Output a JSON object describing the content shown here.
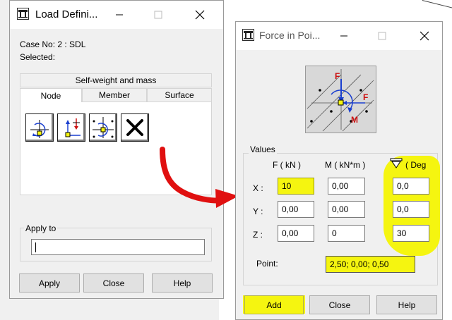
{
  "load_dialog": {
    "title": "Load Defini...",
    "case_label": "Case No: 2 : SDL",
    "selected_label": "Selected:",
    "section_header": "Self-weight and mass",
    "tabs": [
      "Node",
      "Member",
      "Surface"
    ],
    "active_tab": "Node",
    "tool_icons": [
      "nodal-moment-icon",
      "nodal-force-icon",
      "force-in-point-icon",
      "delete-load-icon"
    ],
    "apply_to_label": "Apply to",
    "apply_to_value": "",
    "buttons": {
      "apply": "Apply",
      "close": "Close",
      "help": "Help"
    }
  },
  "force_dialog": {
    "title": "Force in Poi...",
    "diagram_labels": {
      "force_top": "F",
      "force_right": "F",
      "moment": "M"
    },
    "values_group": "Values",
    "col_f": "F  ( kN )",
    "col_m": "M  ( kN*m )",
    "col_deg": "( Deg",
    "rows": [
      {
        "label": "X :",
        "f": "10",
        "m": "0,00",
        "deg": "0,0"
      },
      {
        "label": "Y :",
        "f": "0,00",
        "m": "0,00",
        "deg": "0,0"
      },
      {
        "label": "Z :",
        "f": "0,00",
        "m": "0",
        "deg": "30"
      }
    ],
    "point_label": "Point:",
    "point_value": "2,50; 0,00; 0,50",
    "buttons": {
      "add": "Add",
      "close": "Close",
      "help": "Help"
    }
  },
  "colors": {
    "highlight": "#f5f510",
    "annotation_arrow": "#e01010",
    "accent_blue": "#1a3fcf",
    "load_red": "#cc1010"
  }
}
